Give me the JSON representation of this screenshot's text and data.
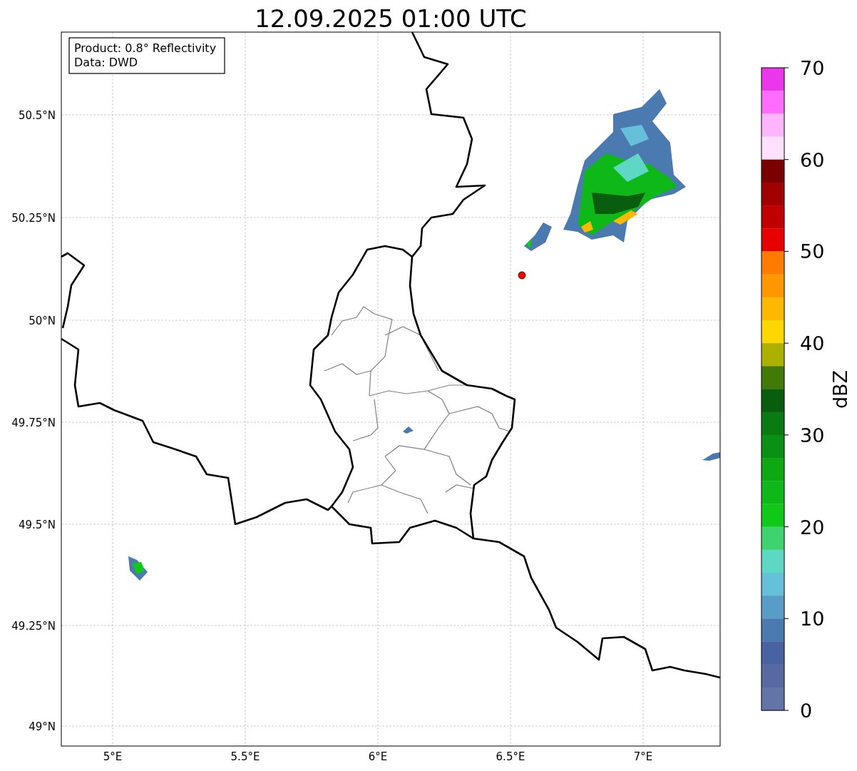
{
  "title": "12.09.2025 01:00 UTC",
  "info_box": {
    "lines": [
      "Product: 0.8° Reflectivity",
      "Data: DWD"
    ]
  },
  "x_axis": {
    "ticks": [
      "5°E",
      "5.5°E",
      "6°E",
      "6.5°E",
      "7°E"
    ]
  },
  "y_axis": {
    "ticks": [
      "50.5°N",
      "50.25°N",
      "50°N",
      "49.75°N",
      "49.5°N",
      "49.25°N",
      "49°N"
    ]
  },
  "colorbar": {
    "label": "dBZ",
    "ticks": [
      "70",
      "60",
      "50",
      "40",
      "30",
      "20",
      "10",
      "0"
    ],
    "segments": [
      {
        "color": "#ec36ec"
      },
      {
        "color": "#ff6cff"
      },
      {
        "color": "#ffb4ff"
      },
      {
        "color": "#ffe0ff"
      },
      {
        "color": "#7a0000"
      },
      {
        "color": "#a00000"
      },
      {
        "color": "#c00000"
      },
      {
        "color": "#e60000"
      },
      {
        "color": "#ff7c00"
      },
      {
        "color": "#ff9800"
      },
      {
        "color": "#ffb800"
      },
      {
        "color": "#ffd700"
      },
      {
        "color": "#aeb000"
      },
      {
        "color": "#427a0a"
      },
      {
        "color": "#085e0e"
      },
      {
        "color": "#0a7a12"
      },
      {
        "color": "#0a9012"
      },
      {
        "color": "#0ea812"
      },
      {
        "color": "#0eb818"
      },
      {
        "color": "#10c818"
      },
      {
        "color": "#3ed36e"
      },
      {
        "color": "#5ed8c4"
      },
      {
        "color": "#66c0da"
      },
      {
        "color": "#5a9cc8"
      },
      {
        "color": "#4a7ab0"
      },
      {
        "color": "#4862a2"
      },
      {
        "color": "#5868a0"
      },
      {
        "color": "#6374a8"
      }
    ]
  }
}
